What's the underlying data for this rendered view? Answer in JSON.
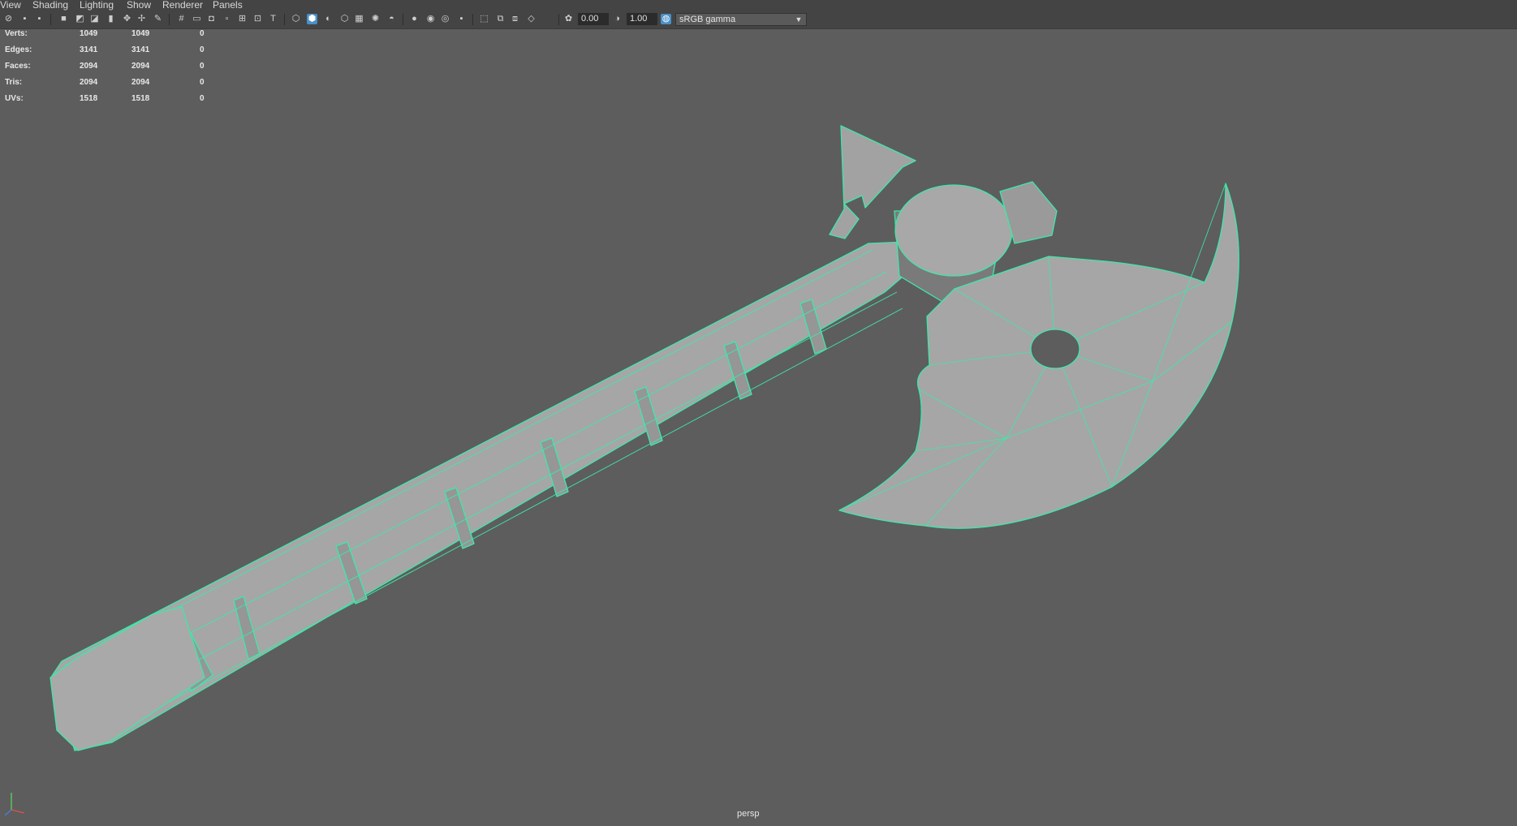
{
  "menu": [
    "View",
    "Shading",
    "Lighting",
    "Show",
    "Renderer",
    "Panels"
  ],
  "toolbar": {
    "exposure": "0.00",
    "gamma": "1.00",
    "color_space": "sRGB gamma"
  },
  "hud": {
    "rows": [
      {
        "label": "Verts:",
        "v1": "1049",
        "v2": "1049",
        "v3": "0"
      },
      {
        "label": "Edges:",
        "v1": "3141",
        "v2": "3141",
        "v3": "0"
      },
      {
        "label": "Faces:",
        "v1": "2094",
        "v2": "2094",
        "v3": "0"
      },
      {
        "label": "Tris:",
        "v1": "2094",
        "v2": "2094",
        "v3": "0"
      },
      {
        "label": "UVs:",
        "v1": "1518",
        "v2": "1518",
        "v3": "0"
      }
    ]
  },
  "viewport": {
    "camera_label": "persp",
    "wire_color": "#3ee8a8",
    "mesh_color": "#a6a6a6",
    "background": "#5d5d5d"
  }
}
